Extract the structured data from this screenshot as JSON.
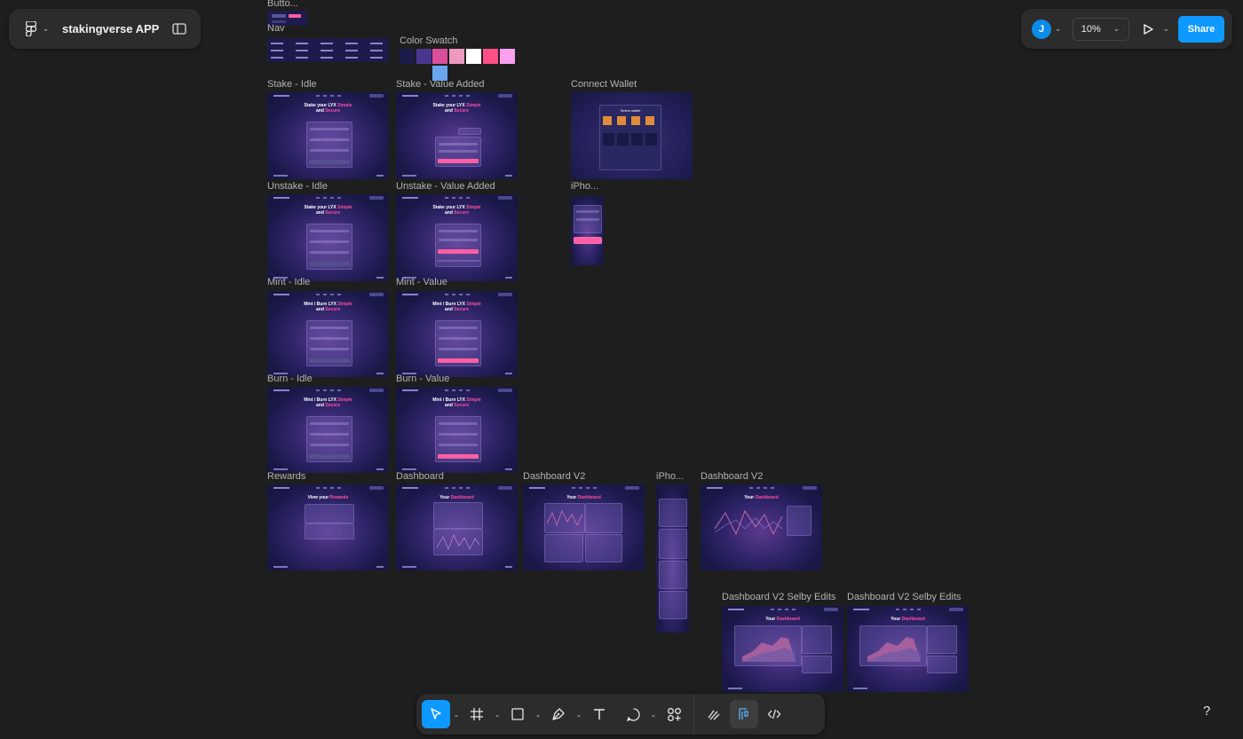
{
  "file": {
    "title": "stakingverse APP"
  },
  "header": {
    "avatar_letter": "J",
    "zoom": "10%",
    "share_label": "Share"
  },
  "frames": {
    "buttons": "Butto...",
    "nav": "Nav",
    "color_swatch": "Color Swatch",
    "stake_idle": "Stake - Idle",
    "stake_value": "Stake - Value Added",
    "connect_wallet": "Connect Wallet",
    "unstake_idle": "Unstake - Idle",
    "unstake_value": "Unstake - Value Added",
    "iphone1": "iPho...",
    "mint_idle": "Mint - Idle",
    "mint_value": "Mint - Value",
    "burn_idle": "Burn - Idle",
    "burn_value": "Burn - Value",
    "rewards": "Rewards",
    "dashboard": "Dashboard",
    "dashboard_v2": "Dashboard V2",
    "iphone2": "iPho...",
    "dashboard_v2b": "Dashboard V2",
    "selby1": "Dashboard V2 Selby Edits",
    "selby2": "Dashboard V2 Selby Edits"
  },
  "mock": {
    "stake_a": "Stake your LYX ",
    "stake_b": "Simple",
    "stake_c": "and ",
    "stake_d": "Secure",
    "mint_a": "Mint / Burn LYX ",
    "rewards_a": "View your ",
    "rewards_b": "Rewards",
    "dash_a": "Your ",
    "dash_b": "Dashboard",
    "wallet_title": "Select wallet"
  },
  "swatches": [
    "#1b1a4a",
    "#4a3590",
    "#d94f9a",
    "#ee99c2",
    "#ffffff",
    "#ff4f87",
    "#f9a0f0",
    "#6aa6f0"
  ],
  "toolbar": {
    "tools": [
      "move-tool",
      "frame-tool",
      "shape-tool",
      "pen-tool",
      "text-tool",
      "comment-tool",
      "actions-tool"
    ],
    "modes": [
      "draw-mode",
      "design-mode",
      "dev-mode"
    ]
  },
  "help_label": "?"
}
